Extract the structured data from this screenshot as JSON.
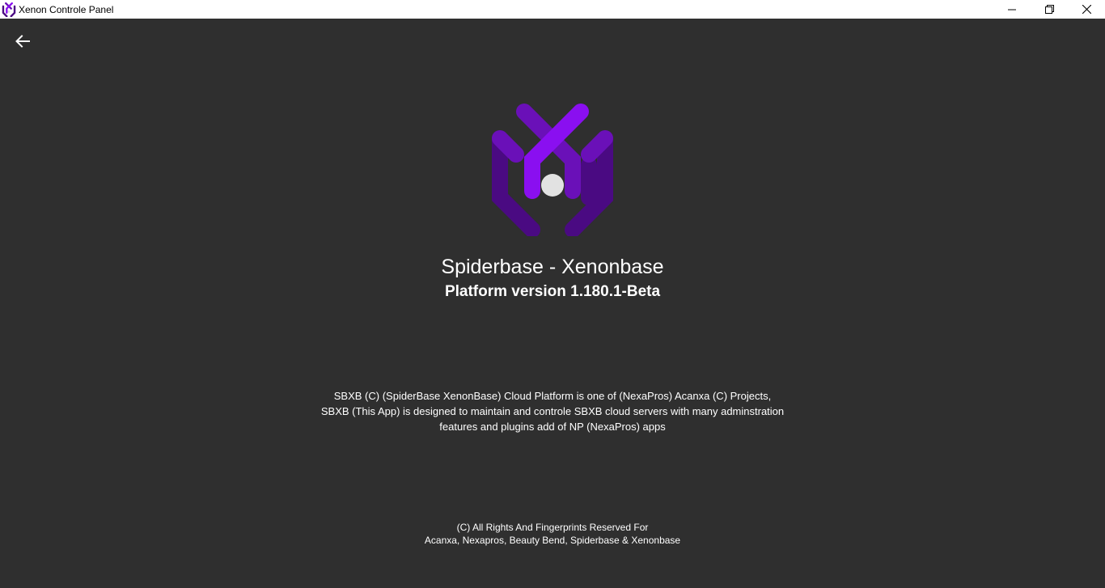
{
  "window": {
    "title": "Xenon Controle Panel",
    "app_icon": "spiderbase-logo-icon",
    "controls": [
      "minimize-icon",
      "restore-icon",
      "close-icon"
    ]
  },
  "navigation": {
    "back_icon": "back-arrow-icon"
  },
  "about": {
    "logo": "spiderbase-logo",
    "app_name": "Spiderbase - Xenonbase",
    "platform_version": "Platform version 1.180.1-Beta",
    "description_lines": [
      "SBXB (C) (SpiderBase XenonBase) Cloud Platform is one of (NexaPros) Acanxa (C) Projects,",
      "SBXB (This App) is designed to maintain and controle SBXB cloud servers with many adminstration",
      "features and plugins add of NP (NexaPros) apps"
    ],
    "copyright_lines": [
      "(C) All Rights And Fingerprints Reserved For",
      "Acanxa, Nexapros, Beauty Bend, Spiderbase & Xenonbase"
    ]
  },
  "colors": {
    "background": "#2f2f2f",
    "titlebar": "#ffffff",
    "logo_light": "#8a0ff0",
    "logo_mid": "#6a10b8",
    "logo_dark": "#4a0a82",
    "logo_dot": "#e2e2e2"
  }
}
